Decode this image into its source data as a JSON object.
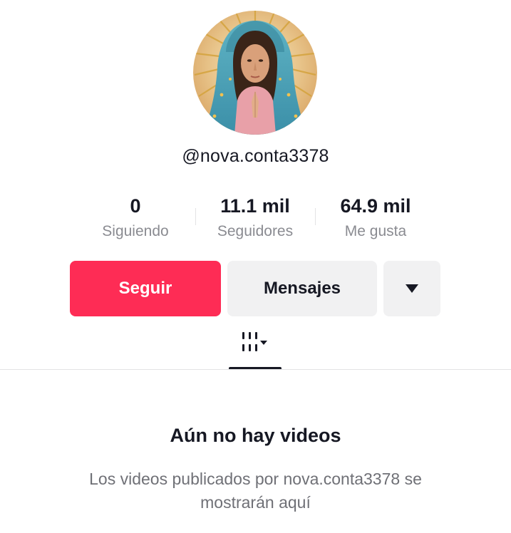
{
  "profile": {
    "username": "@nova.conta3378"
  },
  "stats": [
    {
      "value": "0",
      "label": "Siguiendo"
    },
    {
      "value": "11.1 mil",
      "label": "Seguidores"
    },
    {
      "value": "64.9 mil",
      "label": "Me gusta"
    }
  ],
  "actions": {
    "follow_label": "Seguir",
    "message_label": "Mensajes",
    "more_icon": "caret-down-icon"
  },
  "tabs": {
    "videos_icon": "videos-grid-icon"
  },
  "empty_state": {
    "title": "Aún no hay videos",
    "description": "Los videos publicados por nova.conta3378 se mostrarán aquí"
  },
  "colors": {
    "accent": "#fe2c55",
    "secondary_button": "#f1f1f2",
    "muted_text": "#8a8b91"
  }
}
